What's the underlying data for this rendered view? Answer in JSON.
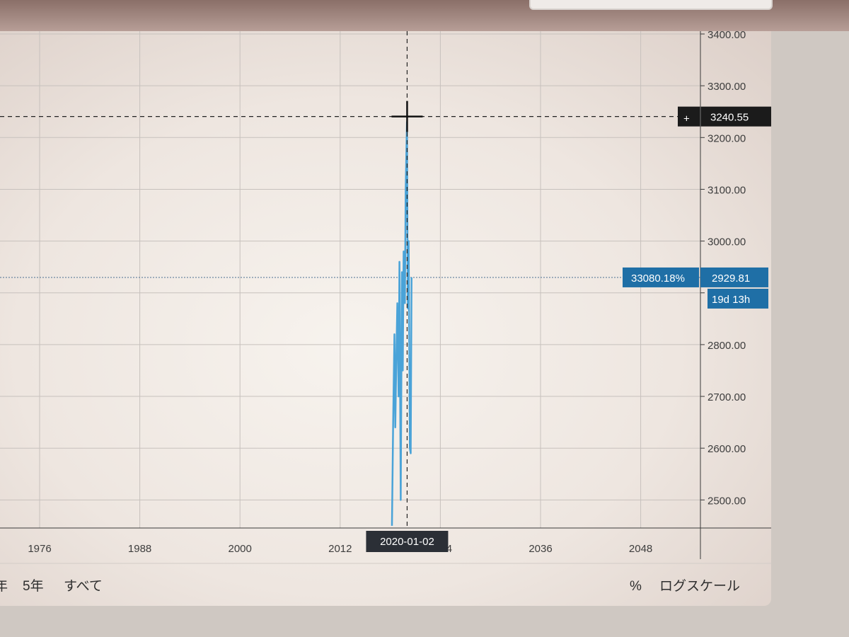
{
  "chart_data": {
    "type": "line",
    "x_ticks": [
      "1976",
      "1988",
      "2000",
      "2012",
      "2024",
      "2036",
      "2048"
    ],
    "y_ticks": [
      "3400.00",
      "3300.00",
      "3200.00",
      "3100.00",
      "3000.00",
      "2900.00",
      "2800.00",
      "2700.00",
      "2600.00",
      "2500.00"
    ],
    "ylim": [
      2450,
      3400
    ],
    "xlim": [
      1965,
      2058
    ],
    "series": [
      {
        "color": "#4aa3d8",
        "x": [
          2018.2,
          2018.35,
          2018.5,
          2018.6,
          2018.75,
          2018.85,
          2019.0,
          2019.1,
          2019.25,
          2019.4,
          2019.5,
          2019.6,
          2019.75,
          2019.85,
          2020.0,
          2020.1,
          2020.2,
          2020.35,
          2020.45,
          2020.55
        ],
        "y": [
          2450,
          2650,
          2820,
          2640,
          2800,
          2880,
          2700,
          2960,
          2500,
          2940,
          2750,
          2980,
          2880,
          3100,
          3230,
          2870,
          3000,
          2600,
          2590,
          2929.81
        ]
      }
    ],
    "crosshair": {
      "date_label": "2020-01-02",
      "price_label": "3240.55"
    },
    "last_price": {
      "label": "2929.81",
      "change_label": "33080.18%",
      "countdown": "19d 13h"
    },
    "grid": true
  },
  "toolbar": {
    "truncated_range": "年",
    "range_5y": "5年",
    "range_all": "すべて",
    "percent": "%",
    "log_scale": "ログスケール",
    "crosshair_plus": "+"
  },
  "colors": {
    "line": "#4aa3d8",
    "label_blue": "#1f6fa6",
    "label_dark": "#1b1b1b"
  }
}
